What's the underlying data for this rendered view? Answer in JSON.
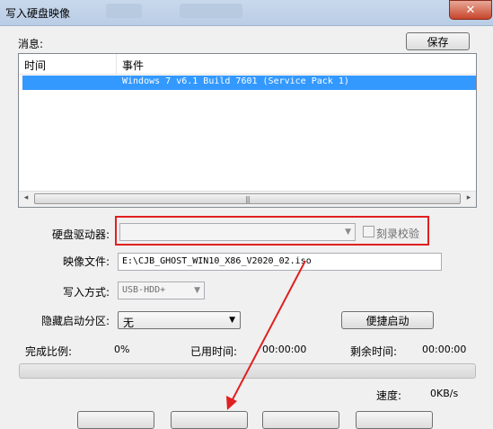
{
  "window": {
    "title": "写入硬盘映像",
    "close_glyph": "✕"
  },
  "messages": {
    "label": "消息:",
    "save_button": "保存",
    "columns": [
      "时间",
      "事件"
    ],
    "rows": [
      {
        "time": "",
        "event": "Windows 7 v6.1 Build 7601 (Service Pack 1)"
      }
    ],
    "scroll_left": "◂",
    "scroll_right": "▸",
    "thumb_grip": "|||"
  },
  "form": {
    "drive_label": "硬盘驱动器:",
    "drive_value": "",
    "verify_label": "刻录校验",
    "verify_checked": false,
    "image_label": "映像文件:",
    "image_value": "E:\\CJB_GHOST_WIN10_X86_V2020_02.iso",
    "write_method_label": "写入方式:",
    "write_method_value": "USB-HDD+",
    "hidden_partition_label": "隐藏启动分区:",
    "hidden_partition_value": "无",
    "quick_boot_button": "便捷启动"
  },
  "status": {
    "done_label": "完成比例:",
    "done_value": "0%",
    "elapsed_label": "已用时间:",
    "elapsed_value": "00:00:00",
    "remaining_label": "剩余时间:",
    "remaining_value": "00:00:00",
    "progress": 0,
    "speed_label": "速度:",
    "speed_value": "0KB/s"
  },
  "annotation": {
    "highlight_color": "#e02020",
    "arrow_color": "#e02020"
  }
}
